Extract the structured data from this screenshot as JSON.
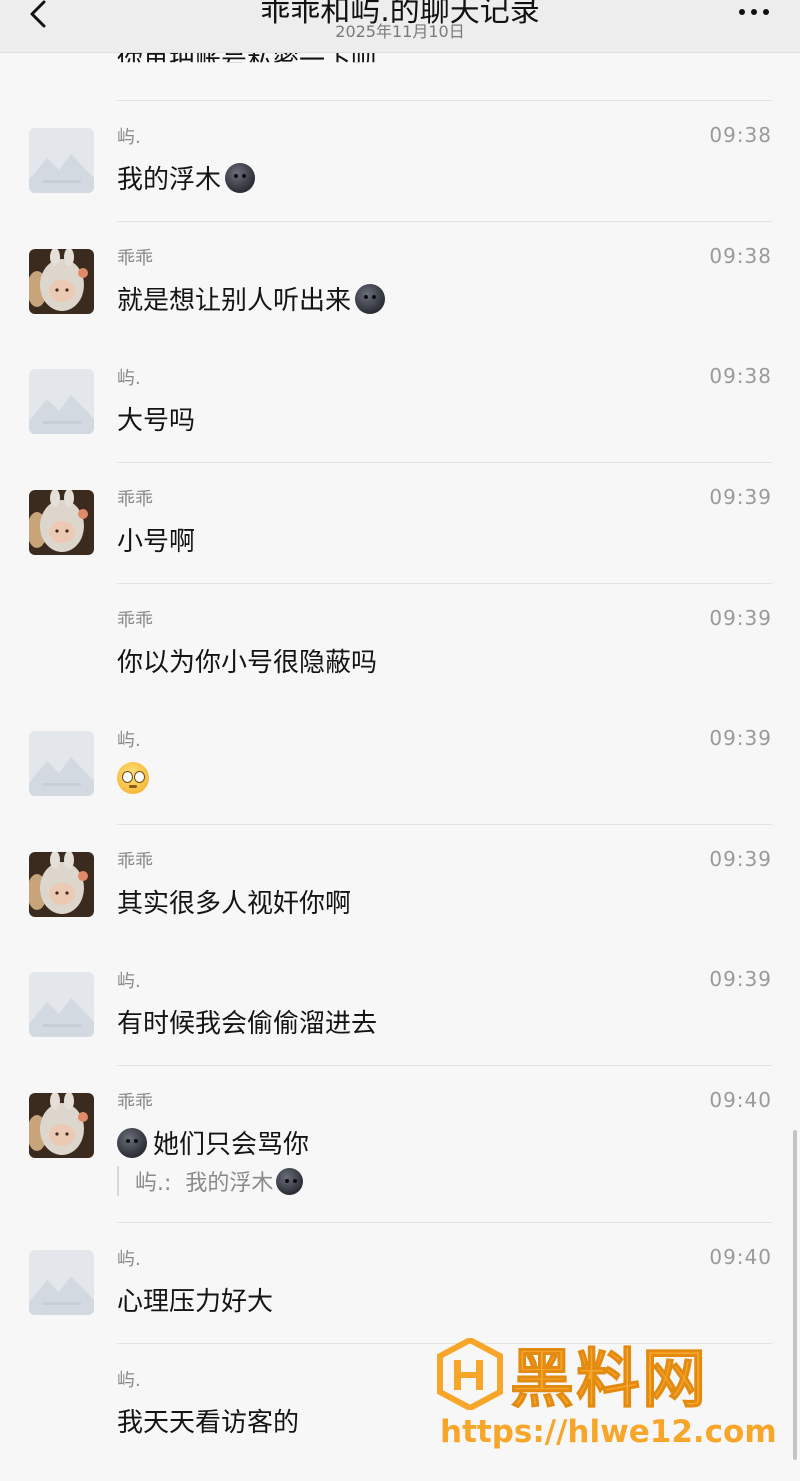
{
  "header": {
    "title": "乖乖和屿.的聊天记录",
    "date": "2025年11月10日"
  },
  "top_partial": {
    "text": "你再把账号私密一下呗"
  },
  "messages": [
    {
      "sender": "屿.",
      "time": "09:38",
      "text": "我的浮木",
      "emoji_after": "dark-face-emoji",
      "avatar": "placeholder"
    },
    {
      "sender": "乖乖",
      "time": "09:38",
      "text": "就是想让别人听出来",
      "emoji_after": "dark-face-emoji",
      "avatar": "doll"
    },
    {
      "sender": "屿.",
      "time": "09:38",
      "text": "大号吗",
      "avatar": "placeholder"
    },
    {
      "sender": "乖乖",
      "time": "09:39",
      "text": "小号啊",
      "avatar": "doll"
    },
    {
      "sender": "乖乖",
      "time": "09:39",
      "text": "你以为你小号很隐蔽吗",
      "avatar": "none"
    },
    {
      "sender": "屿.",
      "time": "09:39",
      "text": "",
      "emoji_only": "pleading-face-emoji",
      "avatar": "placeholder"
    },
    {
      "sender": "乖乖",
      "time": "09:39",
      "text": "其实很多人视奸你啊",
      "avatar": "doll"
    },
    {
      "sender": "屿.",
      "time": "09:39",
      "text": "有时候我会偷偷溜进去",
      "avatar": "placeholder"
    },
    {
      "sender": "乖乖",
      "time": "09:40",
      "text": "她们只会骂你",
      "emoji_before": "dark-face-emoji",
      "avatar": "doll",
      "quote": {
        "sender": "屿.:",
        "text": "我的浮木"
      }
    },
    {
      "sender": "屿.",
      "time": "09:40",
      "text": "心理压力好大",
      "avatar": "placeholder"
    },
    {
      "sender": "屿.",
      "time": "09:40",
      "text": "我天天看访客的",
      "avatar": "none"
    }
  ],
  "watermark": {
    "title": "黑料网",
    "url": "https://hlwe12.com"
  }
}
